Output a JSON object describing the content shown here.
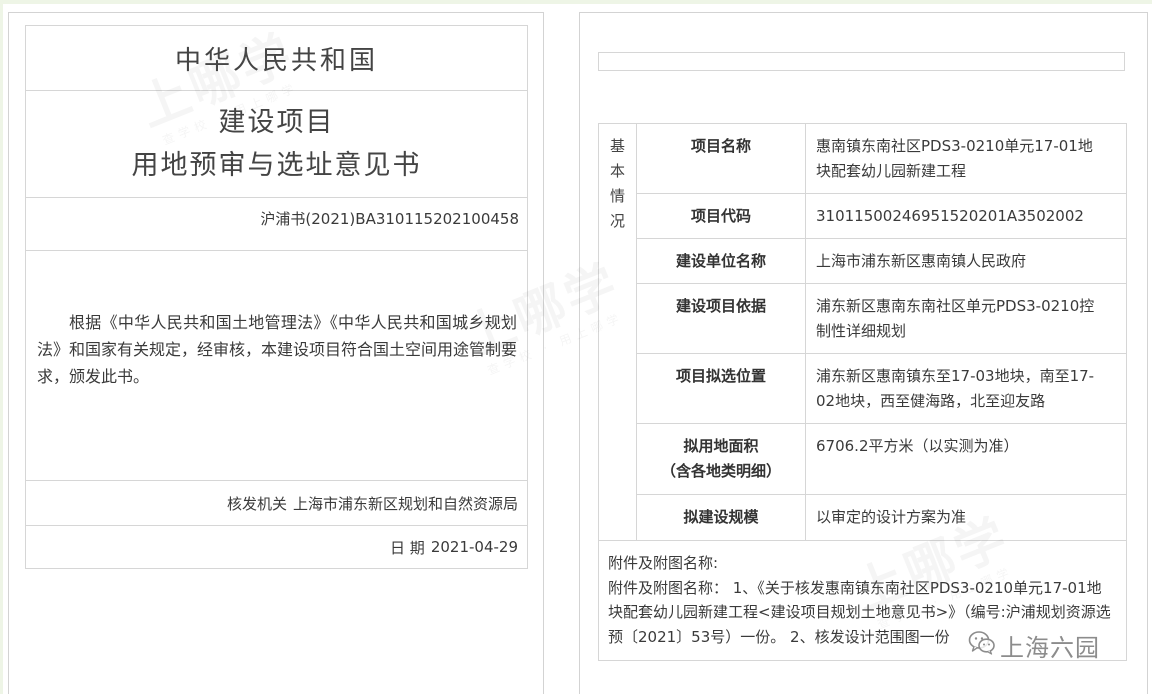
{
  "left": {
    "country": "中华人民共和国",
    "title_line1": "建设项目",
    "title_line2": "用地预审与选址意见书",
    "doc_number": "沪浦书(2021)BA310115202100458",
    "body": "根据《中华人民共和国土地管理法》《中华人民共和国城乡规划法》和国家有关规定，经审核，本建设项目符合国土空间用途管制要求，颁发此书。",
    "issuer_label": "核发机关",
    "issuer": "上海市浦东新区规划和自然资源局",
    "date_label": "日 期",
    "date": "2021-04-29"
  },
  "right": {
    "section_label": "基本情况",
    "rows": [
      {
        "label": "项目名称",
        "value": "惠南镇东南社区PDS3-0210单元17-01地块配套幼儿园新建工程"
      },
      {
        "label": "项目代码",
        "value": "31011500246951520201A3502002"
      },
      {
        "label": "建设单位名称",
        "value": "上海市浦东新区惠南镇人民政府"
      },
      {
        "label": "建设项目依据",
        "value": "浦东新区惠南东南社区单元PDS3-0210控制性详细规划"
      },
      {
        "label": "项目拟选位置",
        "value": "浦东新区惠南镇东至17-03地块，南至17-02地块，西至健海路，北至迎友路"
      },
      {
        "label": "拟用地面积",
        "label_note": "（含各地类明细）",
        "value": "6706.2平方米（以实测为准）"
      },
      {
        "label": "拟建设规模",
        "value": "以审定的设计方案为准"
      }
    ],
    "attachments": {
      "heading": "附件及附图名称:",
      "text": "附件及附图名称： 1、《关于核发惠南镇东南社区PDS3-0210单元17-01地块配套幼儿园新建工程<建设项目规划土地意见书>》（编号:沪浦规划资源选预〔2021〕53号）一份。 2、核发设计范围图一份"
    }
  },
  "watermark": {
    "main": "上哪学",
    "sub": "查学校 · 用上哪学"
  },
  "wechat_watermark": {
    "icon": "wechat-icon",
    "text": "上海六园"
  },
  "colors": {
    "page_background": "#eef5e6",
    "border": "#d6d6d6",
    "text": "#3a3a3a"
  }
}
